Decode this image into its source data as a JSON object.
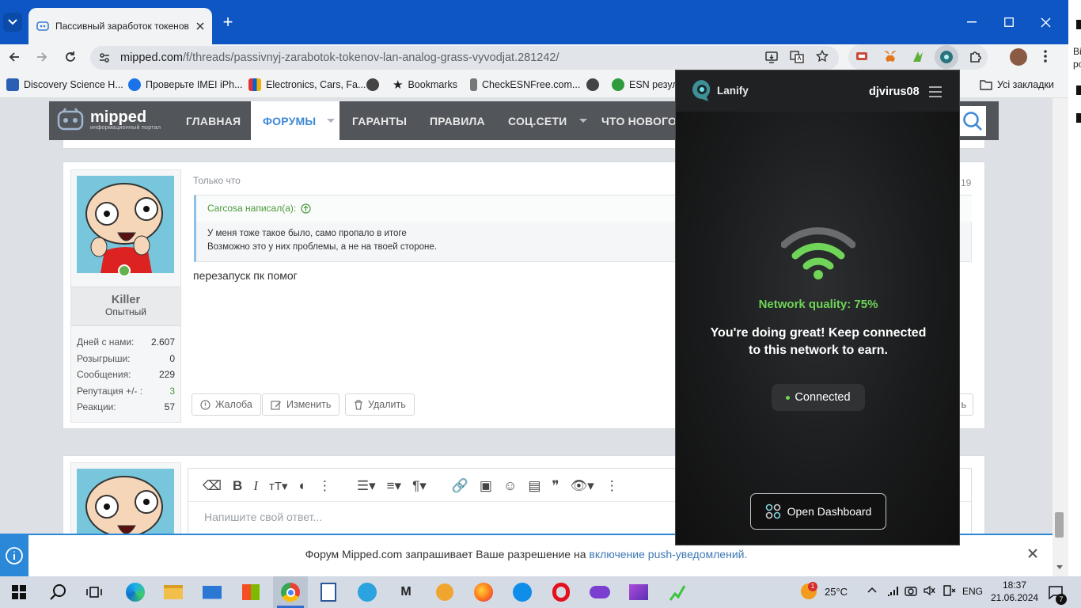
{
  "browser": {
    "tab_title": "Пассивный заработок токенов",
    "url_domain": "mipped.com",
    "url_path": "/f/threads/passivnyj-zarabotok-tokenov-lan-analog-grass-vyvodjat.281242/",
    "bookmarks": [
      {
        "label": "Discovery Science H...",
        "color": "#2b5fb4"
      },
      {
        "label": "Проверьте IMEI iPh...",
        "color": "#1a73e8"
      },
      {
        "label": "Electronics, Cars, Fa...",
        "color": "#e43137"
      },
      {
        "label": "",
        "color": "#444"
      },
      {
        "label": "Bookmarks",
        "color": "#333"
      },
      {
        "label": "CheckESNFree.com...",
        "color": "#777"
      },
      {
        "label": "",
        "color": "#444"
      },
      {
        "label": "ESN резул",
        "color": "#2e9b3d"
      }
    ],
    "all_bookmarks": "Усі закладки"
  },
  "site": {
    "logo_name": "mipped",
    "logo_sub": "информационный портал",
    "nav": [
      "ГЛАВНАЯ",
      "ФОРУМЫ",
      "ГАРАНТЫ",
      "ПРАВИЛА",
      "СОЦ.СЕТИ",
      "ЧТО НОВОГО"
    ]
  },
  "post": {
    "time": "Только что",
    "number_fragment": "19",
    "username": "Killer",
    "rank": "Опытный",
    "stats": [
      {
        "label": "Дней с нами:",
        "value": "2.607"
      },
      {
        "label": "Розыгрыши:",
        "value": "0"
      },
      {
        "label": "Сообщения:",
        "value": "229"
      },
      {
        "label": "Репутация +/- :",
        "value": "3"
      },
      {
        "label": "Реакции:",
        "value": "57"
      }
    ],
    "quote_author": "Carcosa написал(а):",
    "quote_line1": "У меня тоже такое было, само пропало в итоге",
    "quote_line2": "Возможно это у них проблемы, а не на твоей стороне.",
    "body": "перезапуск пк помог",
    "actions": [
      "Жалоба",
      "Изменить",
      "Удалить"
    ],
    "right_fragment": "ь"
  },
  "editor": {
    "placeholder": "Напишите свой ответ..."
  },
  "notification": {
    "text_main": "Форум Mipped.com запрашивает Ваше разрешение на ",
    "text_link": "включение push-уведомлений."
  },
  "popup": {
    "brand": "Lanify",
    "user": "djvirus08",
    "network_quality": "Network quality: 75%",
    "message": "You're doing great! Keep connected to this network to earn.",
    "status": "Connected",
    "dashboard_button": "Open Dashboard",
    "accent": "#6fd457"
  },
  "taskbar": {
    "weather": "25°C",
    "lang": "ENG",
    "time": "18:37",
    "date": "21.06.2024",
    "notif_count": "7",
    "weather_badge": "1"
  },
  "side_text": [
    "Ві",
    "ро"
  ]
}
